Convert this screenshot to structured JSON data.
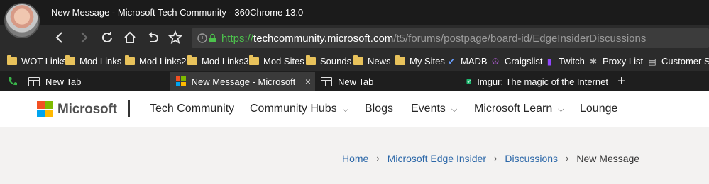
{
  "window": {
    "title": "New Message - Microsoft Tech Community - 360Chrome 13.0"
  },
  "address_bar": {
    "scheme": "https://",
    "host": "techcommunity.microsoft.com",
    "path": "/t5/forums/postpage/board-id/EdgeInsiderDiscussions"
  },
  "bookmarks": [
    {
      "label": "WOT Links",
      "icon": "folder-icon"
    },
    {
      "label": "Mod Links",
      "icon": "folder-icon"
    },
    {
      "label": "Mod Links2",
      "icon": "folder-icon"
    },
    {
      "label": "Mod Links3",
      "icon": "folder-icon"
    },
    {
      "label": "Mod Sites",
      "icon": "folder-icon"
    },
    {
      "label": "Sounds",
      "icon": "folder-icon"
    },
    {
      "label": "News",
      "icon": "folder-icon"
    },
    {
      "label": "My Sites",
      "icon": "folder-icon"
    },
    {
      "label": "MADB",
      "icon": "madb-icon"
    },
    {
      "label": "Craigslist",
      "icon": "peace-icon"
    },
    {
      "label": "Twitch",
      "icon": "twitch-icon"
    },
    {
      "label": "Proxy List",
      "icon": "proxy-icon"
    },
    {
      "label": "Customer Serv",
      "icon": "document-icon"
    }
  ],
  "tabs": [
    {
      "label": "New Tab",
      "active": false
    },
    {
      "label": "New Message - Microsoft Tech",
      "active": true,
      "close": "×"
    },
    {
      "label": "New Tab",
      "active": false
    },
    {
      "label": "Imgur: The magic of the Internet",
      "active": false
    },
    {
      "label": "+"
    }
  ],
  "site_header": {
    "brand": "Microsoft",
    "nav": [
      {
        "label": "Tech Community",
        "dropdown": false
      },
      {
        "label": "Community Hubs",
        "dropdown": true
      },
      {
        "label": "Blogs",
        "dropdown": false
      },
      {
        "label": "Events",
        "dropdown": true
      },
      {
        "label": "Microsoft Learn",
        "dropdown": true
      },
      {
        "label": "Lounge",
        "dropdown": false
      }
    ],
    "chevron": "⌵"
  },
  "breadcrumb": {
    "items": [
      "Home",
      "Microsoft Edge Insider",
      "Discussions"
    ],
    "current": "New Message",
    "separator": "›"
  },
  "colors": {
    "url_scheme": "#4cc24c",
    "link": "#2b67a8",
    "folder": "#e8c25b"
  }
}
